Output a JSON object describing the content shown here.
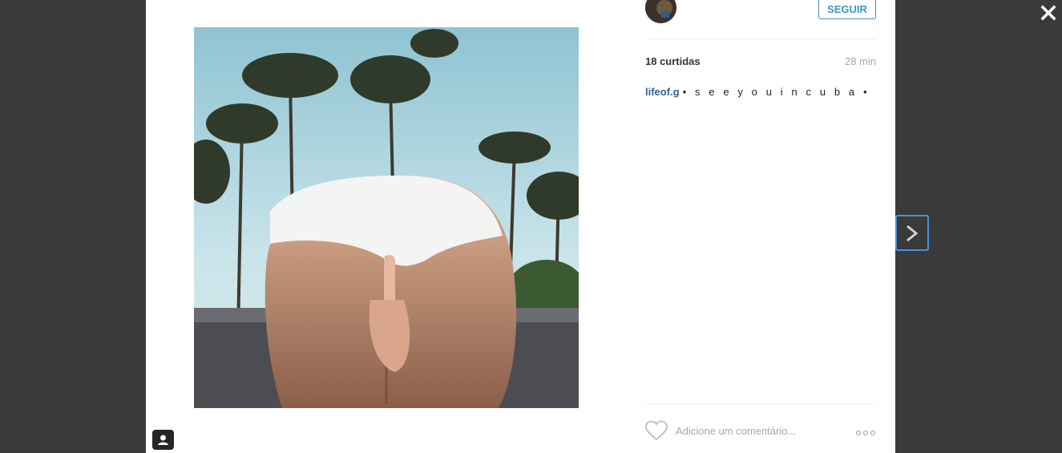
{
  "post": {
    "follow_label": "SEGUIR",
    "likes": "18 curtidas",
    "time": "28 min",
    "author": "lifeof.g",
    "caption": "• s e e y o u i n c u b a •"
  },
  "comment": {
    "placeholder": "Adicione um comentário..."
  },
  "icons": {
    "close": "close-icon",
    "next": "chevron-right-icon",
    "heart": "heart-icon",
    "more": "more-options-icon",
    "user_tag": "user-tag-icon"
  },
  "colors": {
    "accent": "#3f92c9",
    "author_link": "#2c6594",
    "focus_ring": "#4a90d9"
  }
}
